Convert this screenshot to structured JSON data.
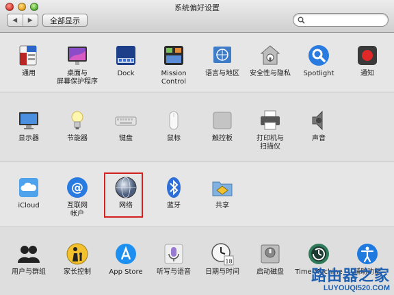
{
  "window": {
    "title": "系统偏好设置",
    "show_all": "全部显示",
    "back": "◀",
    "forward": "▶",
    "search_placeholder": ""
  },
  "sections": [
    {
      "panes": [
        {
          "label": "通用",
          "icon": "general-icon"
        },
        {
          "label": "桌面与\n屏幕保护程序",
          "icon": "desktop-screensaver-icon"
        },
        {
          "label": "Dock",
          "icon": "dock-icon"
        },
        {
          "label": "Mission\nControl",
          "icon": "mission-control-icon"
        },
        {
          "label": "语言与地区",
          "icon": "language-region-icon"
        },
        {
          "label": "安全性与隐私",
          "icon": "security-privacy-icon"
        },
        {
          "label": "Spotlight",
          "icon": "spotlight-icon"
        },
        {
          "label": "通知",
          "icon": "notifications-icon"
        }
      ]
    },
    {
      "panes": [
        {
          "label": "显示器",
          "icon": "displays-icon"
        },
        {
          "label": "节能器",
          "icon": "energy-saver-icon"
        },
        {
          "label": "键盘",
          "icon": "keyboard-icon"
        },
        {
          "label": "鼠标",
          "icon": "mouse-icon"
        },
        {
          "label": "触控板",
          "icon": "trackpad-icon"
        },
        {
          "label": "打印机与\n扫描仪",
          "icon": "printers-scanners-icon"
        },
        {
          "label": "声音",
          "icon": "sound-icon"
        }
      ]
    },
    {
      "panes": [
        {
          "label": "iCloud",
          "icon": "icloud-icon"
        },
        {
          "label": "互联网\n帐户",
          "icon": "internet-accounts-icon"
        },
        {
          "label": "网络",
          "icon": "network-icon"
        },
        {
          "label": "蓝牙",
          "icon": "bluetooth-icon"
        },
        {
          "label": "共享",
          "icon": "sharing-icon"
        }
      ]
    },
    {
      "panes": [
        {
          "label": "用户与群组",
          "icon": "users-groups-icon"
        },
        {
          "label": "家长控制",
          "icon": "parental-controls-icon"
        },
        {
          "label": "App Store",
          "icon": "app-store-icon"
        },
        {
          "label": "听写与语音",
          "icon": "dictation-speech-icon"
        },
        {
          "label": "日期与时间",
          "icon": "date-time-icon"
        },
        {
          "label": "启动磁盘",
          "icon": "startup-disk-icon"
        },
        {
          "label": "Time Machine",
          "icon": "time-machine-icon"
        },
        {
          "label": "辅助功能",
          "icon": "accessibility-icon"
        }
      ]
    }
  ],
  "watermark": {
    "main": "路由器之家",
    "sub": "LUYOUQI520.COM"
  },
  "colors": {
    "highlight": "#d41f1f",
    "watermark": "#1f5fb0"
  }
}
